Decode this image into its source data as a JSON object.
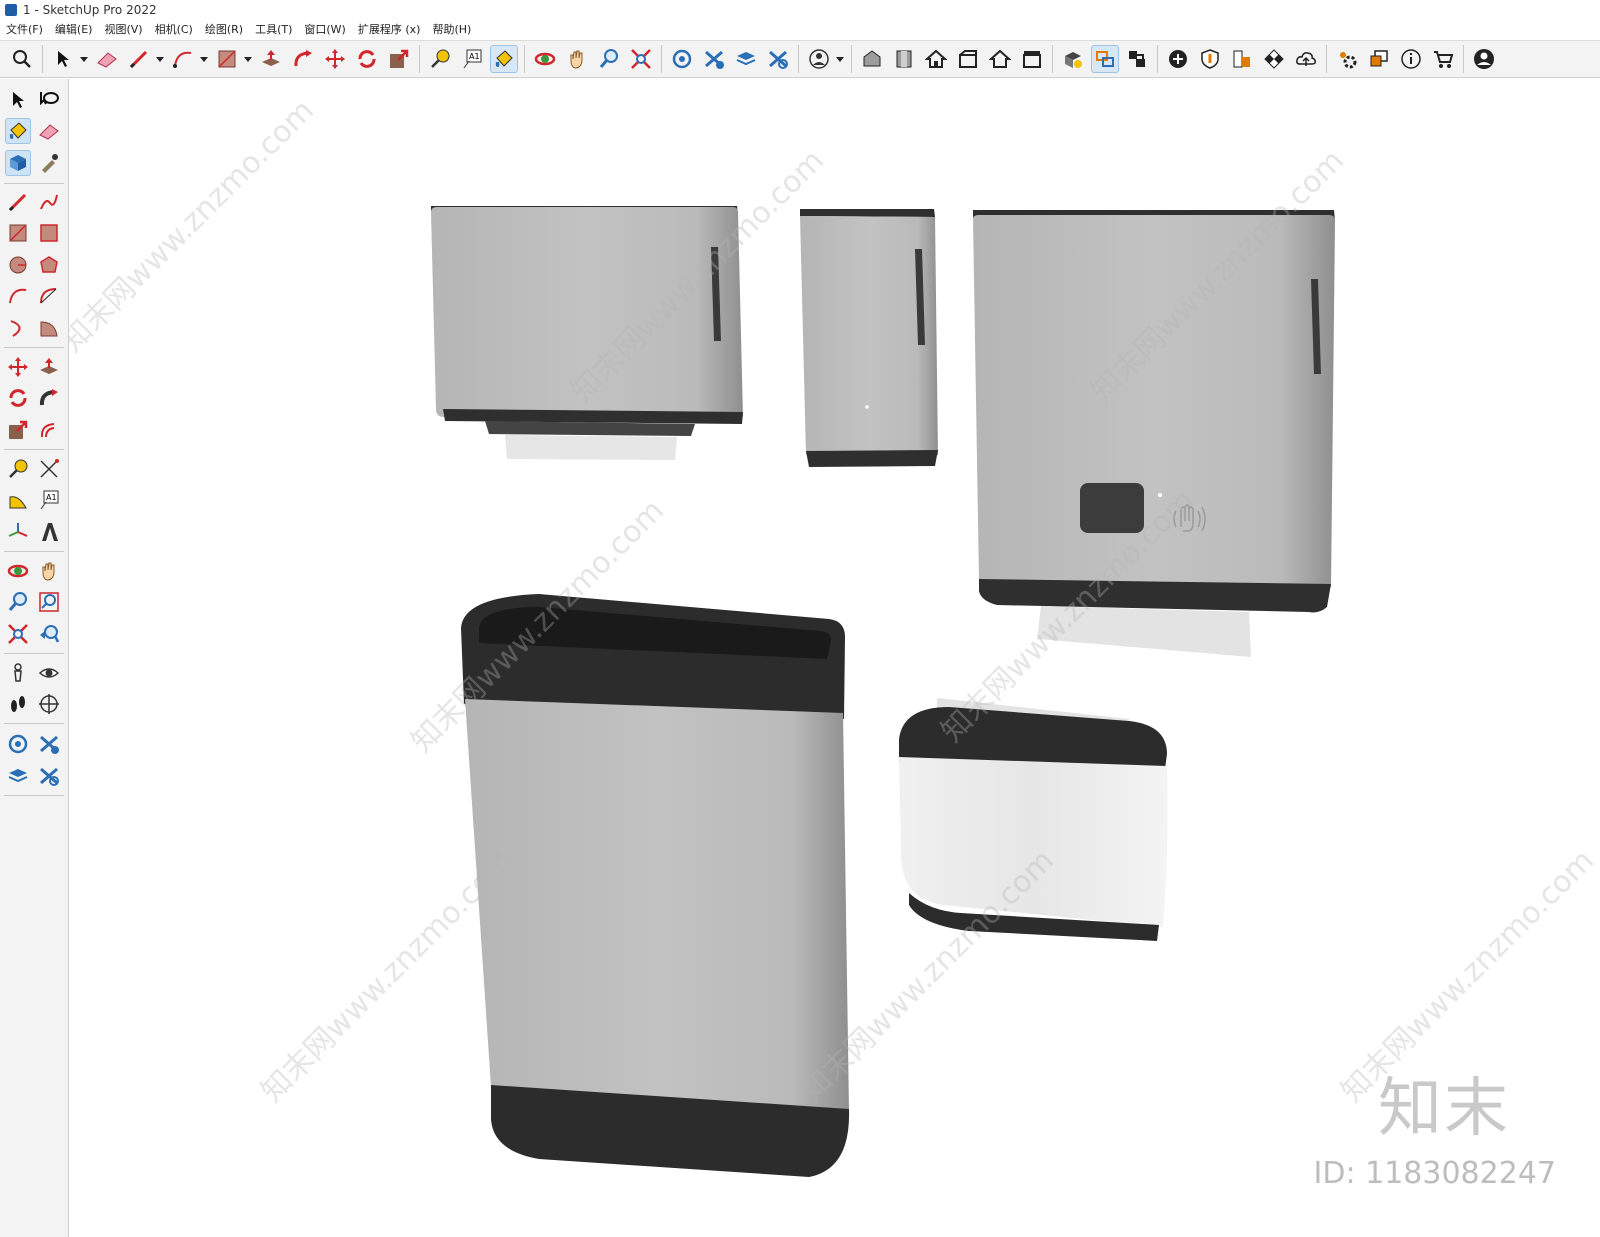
{
  "window": {
    "title": "1 - SketchUp Pro 2022"
  },
  "menu": [
    {
      "key": "file",
      "label": "文件(F)"
    },
    {
      "key": "edit",
      "label": "编辑(E)"
    },
    {
      "key": "view",
      "label": "视图(V)"
    },
    {
      "key": "camera",
      "label": "相机(C)"
    },
    {
      "key": "draw",
      "label": "绘图(R)"
    },
    {
      "key": "tools",
      "label": "工具(T)"
    },
    {
      "key": "window",
      "label": "窗口(W)"
    },
    {
      "key": "extensions",
      "label": "扩展程序 (x)"
    },
    {
      "key": "help",
      "label": "帮助(H)"
    }
  ],
  "toolbar": {
    "active_tool": "paint-bucket"
  },
  "watermark": {
    "text": "知末网www.znzmo.com",
    "brand": "知末",
    "id": "ID: 1183082247"
  },
  "colors": {
    "body_grey": "#bdbdbd",
    "trim_dark": "#2f2f2f",
    "tissue": "#e8e8e8",
    "icon_red": "#d0262c",
    "icon_blue": "#2a6fb5"
  }
}
